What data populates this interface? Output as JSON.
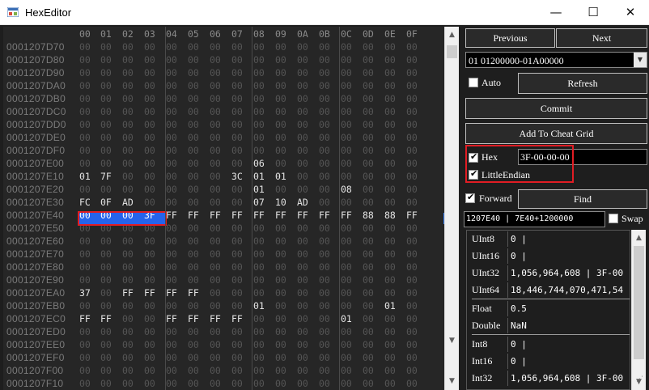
{
  "window": {
    "title": "HexEditor",
    "minimize": "—",
    "maximize": "☐",
    "close": "✕"
  },
  "hex": {
    "columns": [
      "00",
      "01",
      "02",
      "03",
      "04",
      "05",
      "06",
      "07",
      "08",
      "09",
      "0A",
      "0B",
      "0C",
      "0D",
      "0E",
      "0F"
    ],
    "rows": [
      {
        "addr": "0001207D70",
        "bytes": [
          "00",
          "00",
          "00",
          "00",
          "00",
          "00",
          "00",
          "00",
          "00",
          "00",
          "00",
          "00",
          "00",
          "00",
          "00",
          "00"
        ]
      },
      {
        "addr": "0001207D80",
        "bytes": [
          "00",
          "00",
          "00",
          "00",
          "00",
          "00",
          "00",
          "00",
          "00",
          "00",
          "00",
          "00",
          "00",
          "00",
          "00",
          "00"
        ]
      },
      {
        "addr": "0001207D90",
        "bytes": [
          "00",
          "00",
          "00",
          "00",
          "00",
          "00",
          "00",
          "00",
          "00",
          "00",
          "00",
          "00",
          "00",
          "00",
          "00",
          "00"
        ]
      },
      {
        "addr": "0001207DA0",
        "bytes": [
          "00",
          "00",
          "00",
          "00",
          "00",
          "00",
          "00",
          "00",
          "00",
          "00",
          "00",
          "00",
          "00",
          "00",
          "00",
          "00"
        ]
      },
      {
        "addr": "0001207DB0",
        "bytes": [
          "00",
          "00",
          "00",
          "00",
          "00",
          "00",
          "00",
          "00",
          "00",
          "00",
          "00",
          "00",
          "00",
          "00",
          "00",
          "00"
        ]
      },
      {
        "addr": "0001207DC0",
        "bytes": [
          "00",
          "00",
          "00",
          "00",
          "00",
          "00",
          "00",
          "00",
          "00",
          "00",
          "00",
          "00",
          "00",
          "00",
          "00",
          "00"
        ]
      },
      {
        "addr": "0001207DD0",
        "bytes": [
          "00",
          "00",
          "00",
          "00",
          "00",
          "00",
          "00",
          "00",
          "00",
          "00",
          "00",
          "00",
          "00",
          "00",
          "00",
          "00"
        ]
      },
      {
        "addr": "0001207DE0",
        "bytes": [
          "00",
          "00",
          "00",
          "00",
          "00",
          "00",
          "00",
          "00",
          "00",
          "00",
          "00",
          "00",
          "00",
          "00",
          "00",
          "00"
        ]
      },
      {
        "addr": "0001207DF0",
        "bytes": [
          "00",
          "00",
          "00",
          "00",
          "00",
          "00",
          "00",
          "00",
          "00",
          "00",
          "00",
          "00",
          "00",
          "00",
          "00",
          "00"
        ]
      },
      {
        "addr": "0001207E00",
        "bytes": [
          "00",
          "00",
          "00",
          "00",
          "00",
          "00",
          "00",
          "00",
          "06",
          "00",
          "00",
          "00",
          "00",
          "00",
          "00",
          "00"
        ]
      },
      {
        "addr": "0001207E10",
        "bytes": [
          "01",
          "7F",
          "00",
          "00",
          "00",
          "00",
          "00",
          "3C",
          "01",
          "01",
          "00",
          "00",
          "00",
          "00",
          "00",
          "00"
        ]
      },
      {
        "addr": "0001207E20",
        "bytes": [
          "00",
          "00",
          "00",
          "00",
          "00",
          "00",
          "00",
          "00",
          "01",
          "00",
          "00",
          "00",
          "08",
          "00",
          "00",
          "00"
        ]
      },
      {
        "addr": "0001207E30",
        "bytes": [
          "FC",
          "0F",
          "AD",
          "00",
          "00",
          "00",
          "00",
          "00",
          "07",
          "10",
          "AD",
          "00",
          "00",
          "00",
          "00",
          "00"
        ]
      },
      {
        "addr": "0001207E40",
        "bytes": [
          "00",
          "00",
          "00",
          "3F",
          "FF",
          "FF",
          "FF",
          "FF",
          "FF",
          "FF",
          "FF",
          "FF",
          "FF",
          "88",
          "88",
          "FF"
        ]
      },
      {
        "addr": "0001207E50",
        "bytes": [
          "00",
          "00",
          "00",
          "00",
          "00",
          "00",
          "00",
          "00",
          "00",
          "00",
          "00",
          "00",
          "00",
          "00",
          "00",
          "00"
        ]
      },
      {
        "addr": "0001207E60",
        "bytes": [
          "00",
          "00",
          "00",
          "00",
          "00",
          "00",
          "00",
          "00",
          "00",
          "00",
          "00",
          "00",
          "00",
          "00",
          "00",
          "00"
        ]
      },
      {
        "addr": "0001207E70",
        "bytes": [
          "00",
          "00",
          "00",
          "00",
          "00",
          "00",
          "00",
          "00",
          "00",
          "00",
          "00",
          "00",
          "00",
          "00",
          "00",
          "00"
        ]
      },
      {
        "addr": "0001207E80",
        "bytes": [
          "00",
          "00",
          "00",
          "00",
          "00",
          "00",
          "00",
          "00",
          "00",
          "00",
          "00",
          "00",
          "00",
          "00",
          "00",
          "00"
        ]
      },
      {
        "addr": "0001207E90",
        "bytes": [
          "00",
          "00",
          "00",
          "00",
          "00",
          "00",
          "00",
          "00",
          "00",
          "00",
          "00",
          "00",
          "00",
          "00",
          "00",
          "00"
        ]
      },
      {
        "addr": "0001207EA0",
        "bytes": [
          "37",
          "00",
          "FF",
          "FF",
          "FF",
          "FF",
          "00",
          "00",
          "00",
          "00",
          "00",
          "00",
          "00",
          "00",
          "00",
          "00"
        ]
      },
      {
        "addr": "0001207EB0",
        "bytes": [
          "00",
          "00",
          "00",
          "00",
          "00",
          "00",
          "00",
          "00",
          "01",
          "00",
          "00",
          "00",
          "00",
          "00",
          "01",
          "00"
        ]
      },
      {
        "addr": "0001207EC0",
        "bytes": [
          "FF",
          "FF",
          "00",
          "00",
          "FF",
          "FF",
          "FF",
          "FF",
          "00",
          "00",
          "00",
          "00",
          "01",
          "00",
          "00",
          "00"
        ]
      },
      {
        "addr": "0001207ED0",
        "bytes": [
          "00",
          "00",
          "00",
          "00",
          "00",
          "00",
          "00",
          "00",
          "00",
          "00",
          "00",
          "00",
          "00",
          "00",
          "00",
          "00"
        ]
      },
      {
        "addr": "0001207EE0",
        "bytes": [
          "00",
          "00",
          "00",
          "00",
          "00",
          "00",
          "00",
          "00",
          "00",
          "00",
          "00",
          "00",
          "00",
          "00",
          "00",
          "00"
        ]
      },
      {
        "addr": "0001207EF0",
        "bytes": [
          "00",
          "00",
          "00",
          "00",
          "00",
          "00",
          "00",
          "00",
          "00",
          "00",
          "00",
          "00",
          "00",
          "00",
          "00",
          "00"
        ]
      },
      {
        "addr": "0001207F00",
        "bytes": [
          "00",
          "00",
          "00",
          "00",
          "00",
          "00",
          "00",
          "00",
          "00",
          "00",
          "00",
          "00",
          "00",
          "00",
          "00",
          "00"
        ]
      },
      {
        "addr": "0001207F10",
        "bytes": [
          "00",
          "00",
          "00",
          "00",
          "00",
          "00",
          "00",
          "00",
          "00",
          "00",
          "00",
          "00",
          "00",
          "00",
          "00",
          "00"
        ]
      }
    ],
    "selected": {
      "row": 13,
      "cols": [
        0,
        1,
        2,
        3
      ]
    }
  },
  "scrollbar": {
    "up": "▲",
    "down": "▼"
  },
  "panel": {
    "previous": "Previous",
    "next": "Next",
    "collapse_glyph": "❯",
    "region_value": "01 01200000-01A00000",
    "region_drop": "▼",
    "auto_label": "Auto",
    "auto_checked": false,
    "refresh": "Refresh",
    "commit": "Commit",
    "add_to_cheat_grid": "Add To Cheat Grid",
    "hex_label": "Hex",
    "hex_checked": true,
    "hex_value": "3F-00-00-00",
    "little_endian_label": "LittleEndian",
    "little_endian_checked": true,
    "forward_label": "Forward",
    "forward_checked": true,
    "find": "Find",
    "offset_text": "1207E40 | 7E40+1200000",
    "swap_label": "Swap",
    "swap_checked": false,
    "check_glyph": "✔",
    "values": [
      {
        "name": "UInt8",
        "value": "0 |"
      },
      {
        "name": "UInt16",
        "value": "0 |"
      },
      {
        "name": "UInt32",
        "value": "1,056,964,608 | 3F-00"
      },
      {
        "name": "UInt64",
        "value": "18,446,744,070,471,54"
      },
      {
        "name": "Float",
        "value": "0.5"
      },
      {
        "name": "Double",
        "value": "NaN"
      },
      {
        "name": "Int8",
        "value": "0 |"
      },
      {
        "name": "Int16",
        "value": "0 |"
      },
      {
        "name": "Int32",
        "value": "1,056,964,608 | 3F-00"
      }
    ],
    "grip": "⋰"
  }
}
